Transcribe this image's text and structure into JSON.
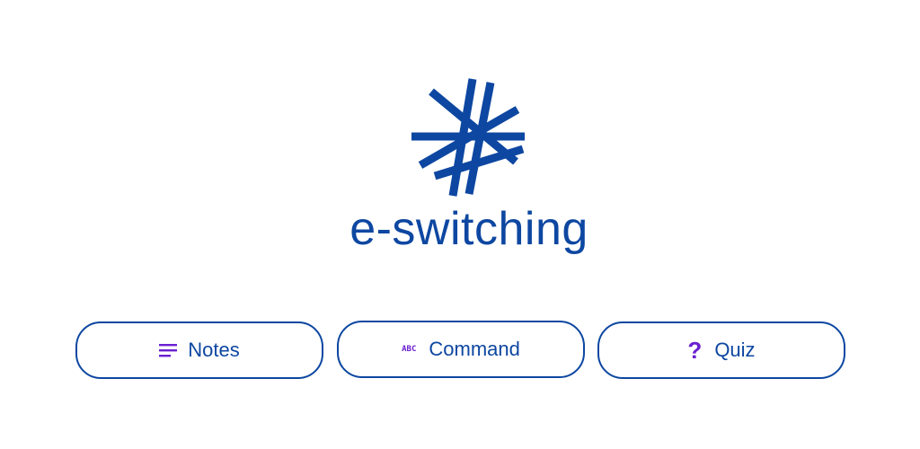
{
  "app": {
    "title": "e-switching",
    "logo_icon": "asterisk-snowflake-icon"
  },
  "actions": [
    {
      "label": "Notes",
      "icon": "notes-lines-icon"
    },
    {
      "label": "Command",
      "icon": "abc-text-icon",
      "icon_text": "ABC"
    },
    {
      "label": "Quiz",
      "icon": "question-mark-icon",
      "icon_text": "?"
    }
  ],
  "colors": {
    "brand": "#0d47a1",
    "accent_icon": "#6a1fd1",
    "background": "#ffffff"
  }
}
